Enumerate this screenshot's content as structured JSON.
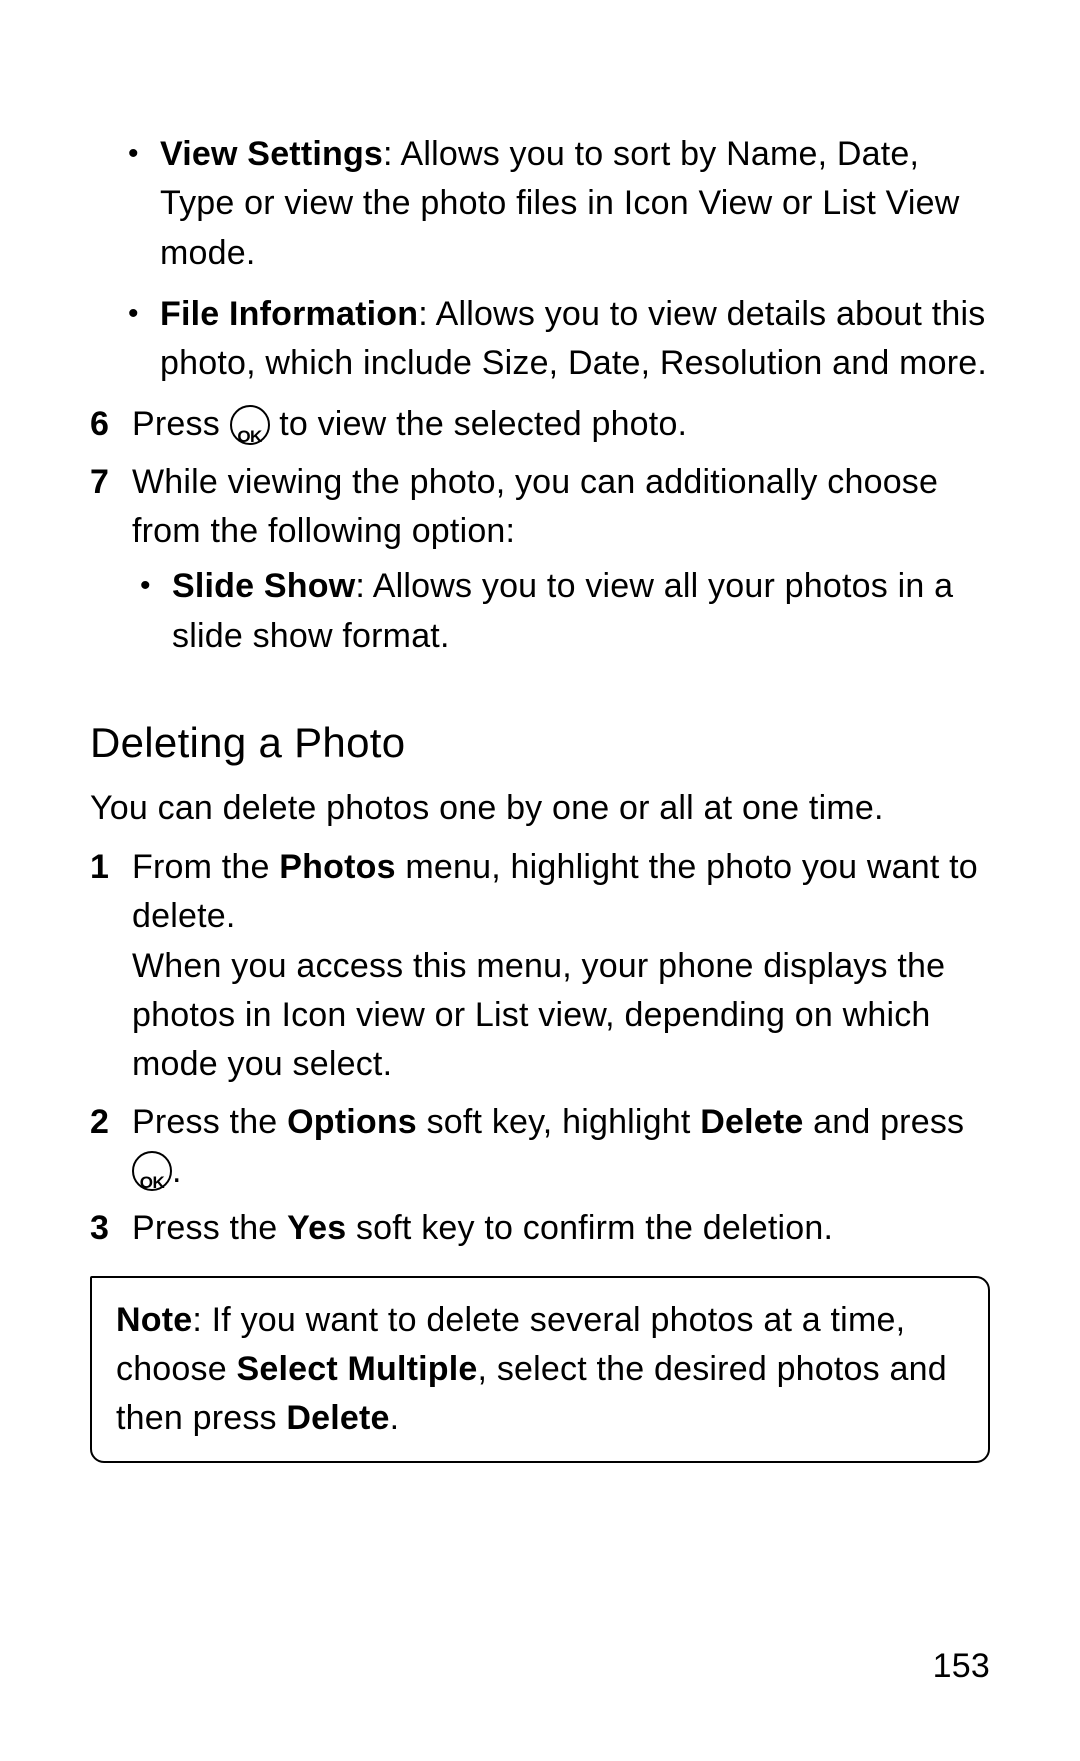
{
  "bullets_top": [
    {
      "bold": "View Settings",
      "rest": ": Allows you to sort by Name, Date, Type or view the photo files in Icon View or List View mode."
    },
    {
      "bold": "File Information",
      "rest": ": Allows you to view details about this photo, which include Size, Date, Resolution and more."
    }
  ],
  "step6": {
    "num": "6",
    "pre": "Press ",
    "post": " to view the selected photo."
  },
  "step7": {
    "num": "7",
    "text": "While viewing the photo, you can additionally choose from the following option:",
    "bullet": {
      "bold": "Slide Show",
      "rest": ": Allows you to view all your photos in a slide show format."
    }
  },
  "section_title": "Deleting a Photo",
  "section_intro": "You can delete photos one by one or all at one time.",
  "del_step1": {
    "num": "1",
    "l1a": "From the ",
    "l1b": "Photos",
    "l1c": " menu, highlight the photo you want to delete.",
    "l2": "When you access this menu, your phone displays the photos in Icon view or List view, depending on which mode you select."
  },
  "del_step2": {
    "num": "2",
    "a": "Press the ",
    "b": "Options",
    "c": " soft key, highlight ",
    "d": "Delete",
    "e": " and press ",
    "f": "."
  },
  "del_step3": {
    "num": "3",
    "a": "Press the ",
    "b": "Yes",
    "c": " soft key to confirm the deletion."
  },
  "note": {
    "label": "Note",
    "a": ": If you want to delete several photos at a time, choose ",
    "b": "Select Multiple",
    "c": ", select the desired photos and then press ",
    "d": "Delete",
    "e": "."
  },
  "page_number": "153"
}
